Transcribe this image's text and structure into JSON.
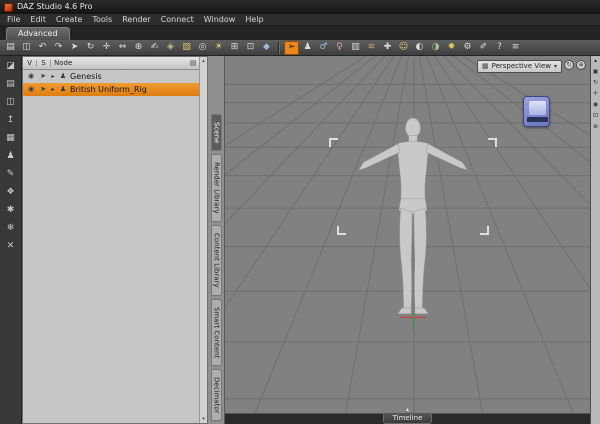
{
  "colors": {
    "accent_orange": "#e8881f",
    "selected_row": "#dd7d10",
    "viewport_bg": "#818181",
    "grid_line": "#6f6f6f",
    "thumb_blue": "#6a74bb"
  },
  "titlebar": {
    "title": "DAZ Studio 4.6 Pro"
  },
  "menubar": {
    "items": [
      {
        "name": "menu-file",
        "label": "File"
      },
      {
        "name": "menu-edit",
        "label": "Edit"
      },
      {
        "name": "menu-create",
        "label": "Create"
      },
      {
        "name": "menu-tools",
        "label": "Tools"
      },
      {
        "name": "menu-render",
        "label": "Render"
      },
      {
        "name": "menu-connect",
        "label": "Connect"
      },
      {
        "name": "menu-window",
        "label": "Window"
      },
      {
        "name": "menu-help",
        "label": "Help"
      }
    ]
  },
  "activity_tab": {
    "label": "Advanced"
  },
  "toolbar": {
    "group1": [
      {
        "name": "open-file-icon",
        "glyph": "▤"
      },
      {
        "name": "save-file-icon",
        "glyph": "◫"
      },
      {
        "name": "undo-icon",
        "glyph": "↶"
      },
      {
        "name": "redo-icon",
        "glyph": "↷"
      },
      {
        "name": "node-selection-tool-icon",
        "glyph": "➤"
      },
      {
        "name": "rotate-tool-icon",
        "glyph": "↻"
      },
      {
        "name": "translate-tool-icon",
        "glyph": "✛"
      },
      {
        "name": "scale-tool-icon",
        "glyph": "⇔"
      },
      {
        "name": "universal-tool-icon",
        "glyph": "⊕"
      },
      {
        "name": "active-pose-tool-icon",
        "glyph": "✍"
      },
      {
        "name": "surface-selection-tool-icon",
        "glyph": "◈",
        "tint": "#a8c887"
      },
      {
        "name": "spot-render-tool-icon",
        "glyph": "▧",
        "tint": "#d8c070"
      },
      {
        "name": "camera-icon",
        "glyph": "◎"
      },
      {
        "name": "light-icon",
        "glyph": "☀",
        "tint": "#e0d080"
      },
      {
        "name": "create-null-icon",
        "glyph": "⊞"
      },
      {
        "name": "create-camera-icon",
        "glyph": "⊡"
      },
      {
        "name": "primitive-icon",
        "glyph": "◆",
        "tint": "#9fb8d8"
      }
    ],
    "group2": [
      {
        "name": "scene-navigator-tool-icon",
        "glyph": "➢",
        "active": true
      },
      {
        "name": "figure-icon",
        "glyph": "♟"
      },
      {
        "name": "male-icon",
        "glyph": "♂",
        "tint": "#9fb8d8"
      },
      {
        "name": "female-icon",
        "glyph": "♀",
        "tint": "#d8a0b8"
      },
      {
        "name": "wardrobe-icon",
        "glyph": "▥"
      },
      {
        "name": "hair-icon",
        "glyph": "≋",
        "tint": "#c8b070"
      },
      {
        "name": "pose-icon",
        "glyph": "✚"
      },
      {
        "name": "expression-icon",
        "glyph": "☺",
        "tint": "#e0d080"
      },
      {
        "name": "shaping-icon",
        "glyph": "◐"
      },
      {
        "name": "surfaces-icon",
        "glyph": "◑",
        "tint": "#a8c887"
      },
      {
        "name": "environment-icon",
        "glyph": "✹",
        "tint": "#e0c060"
      },
      {
        "name": "render-settings-icon",
        "glyph": "⚙"
      },
      {
        "name": "script-icon",
        "glyph": "✐"
      },
      {
        "name": "help-icon",
        "glyph": "?"
      },
      {
        "name": "panel-menu-icon",
        "glyph": "≡"
      }
    ]
  },
  "left_toolbar": {
    "items": [
      {
        "name": "store-icon",
        "glyph": "◪"
      },
      {
        "name": "open-icon",
        "glyph": "▤"
      },
      {
        "name": "save-icon",
        "glyph": "◫"
      },
      {
        "name": "export-icon",
        "glyph": "↥"
      },
      {
        "name": "scene-grid-icon",
        "glyph": "▦"
      },
      {
        "name": "figure-icon",
        "glyph": "♟"
      },
      {
        "name": "edit-icon",
        "glyph": "✎"
      },
      {
        "name": "surfaces-icon",
        "glyph": "❖"
      },
      {
        "name": "settings-icon",
        "glyph": "✱"
      },
      {
        "name": "snowflake-icon",
        "glyph": "❄"
      },
      {
        "name": "close-icon",
        "glyph": "✕"
      }
    ]
  },
  "scene_panel": {
    "header": {
      "col_v": "V",
      "col_s": "S",
      "col_node": "Node"
    },
    "icons": {
      "eye": "◉",
      "cursor": "➤",
      "caret": "▸",
      "figure": "♟",
      "panel_menu": "▤",
      "scroll_up": "▴",
      "scroll_down": "▾"
    },
    "rows": [
      {
        "name": "scene-row-genesis",
        "label": "Genesis",
        "selected": false
      },
      {
        "name": "scene-row-british-uniform-rig",
        "label": "British Uniform_Rig",
        "selected": true
      }
    ]
  },
  "pane_tabs": {
    "items": [
      {
        "name": "tab-scene",
        "label": "Scene",
        "active": true
      },
      {
        "name": "tab-render-library",
        "label": "Render Library",
        "active": false
      },
      {
        "name": "tab-content-library",
        "label": "Content Library",
        "active": false
      },
      {
        "name": "tab-smart-content",
        "label": "Smart Content",
        "active": false
      },
      {
        "name": "tab-decimator",
        "label": "Decimator",
        "active": false
      }
    ]
  },
  "viewport": {
    "view_selector_label": "Perspective View",
    "selector_icon": "▦",
    "selector_caret": "▾",
    "circle1_glyph": "↻",
    "circle2_glyph": "⊕",
    "timeline_label": "Timeline",
    "timeline_marker": "▴"
  },
  "view_rail": {
    "items": [
      {
        "name": "scroll-up-icon",
        "glyph": "▴"
      },
      {
        "name": "orbit-cube-icon",
        "glyph": "▣"
      },
      {
        "name": "rotate-view-icon",
        "glyph": "↻"
      },
      {
        "name": "pan-view-icon",
        "glyph": "✛"
      },
      {
        "name": "zoom-view-icon",
        "glyph": "◉"
      },
      {
        "name": "frame-view-icon",
        "glyph": "⊡"
      },
      {
        "name": "aim-view-icon",
        "glyph": "⊕"
      }
    ]
  }
}
